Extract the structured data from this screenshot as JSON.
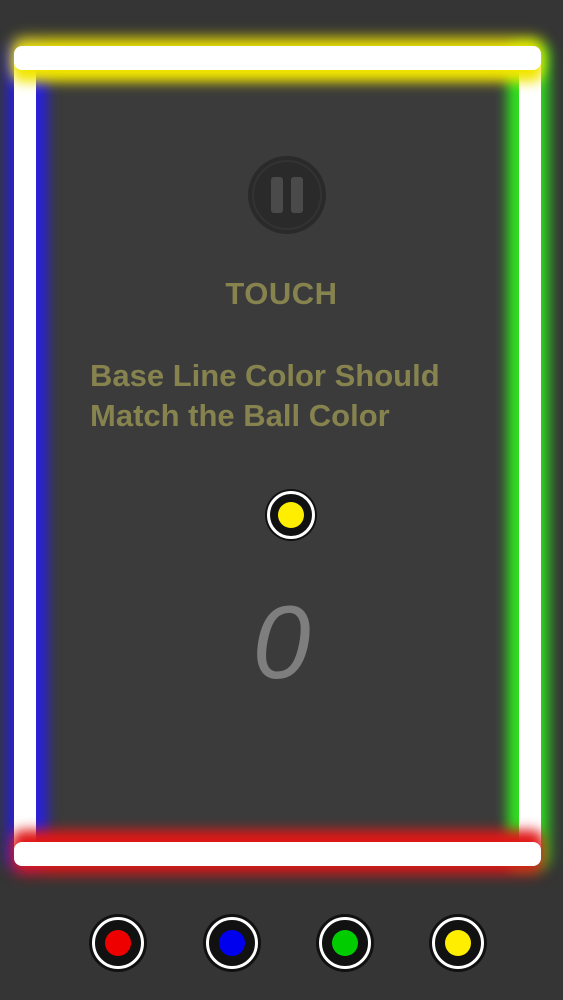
{
  "game": {
    "hint_title": "TOUCH",
    "instruction_line1": "Base Line Color Should",
    "instruction_line2": "Match the Ball Color",
    "score": "0",
    "ball_color": "#ffee00"
  },
  "walls": {
    "top_glow": "#f2e600",
    "bottom_glow": "#e01818",
    "left_glow": "#2a22d8",
    "right_glow": "#30e020"
  },
  "controls": {
    "pause_icon": "pause-icon",
    "color_buttons": [
      {
        "name": "red",
        "color": "#ee0000"
      },
      {
        "name": "blue",
        "color": "#0000ee"
      },
      {
        "name": "green",
        "color": "#00cc00"
      },
      {
        "name": "yellow",
        "color": "#ffee00"
      }
    ]
  }
}
